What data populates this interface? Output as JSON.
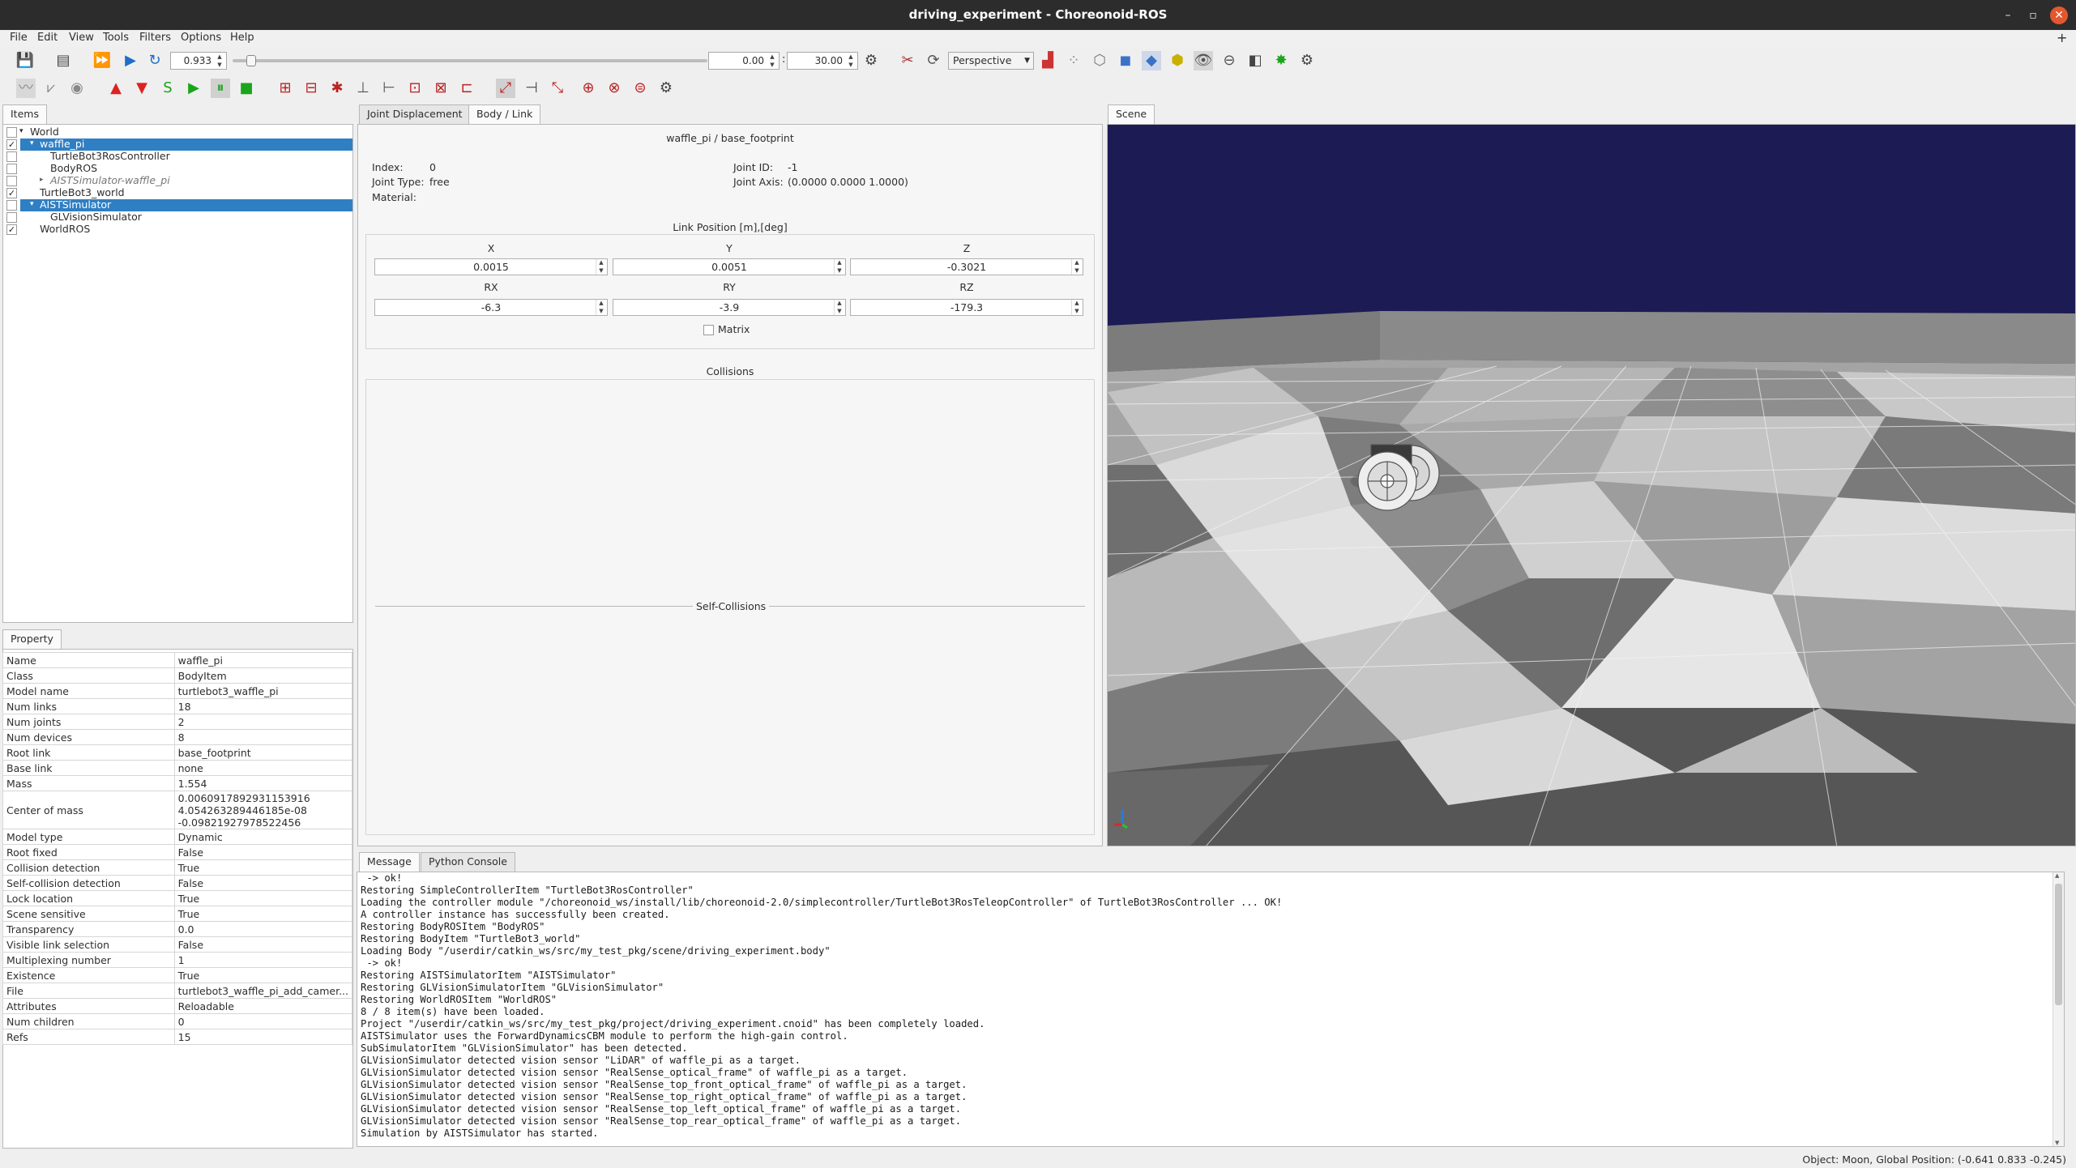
{
  "window": {
    "title": "driving_experiment - Choreonoid-ROS",
    "minimize": "–",
    "maximize": "▫",
    "close": "✕"
  },
  "menu": [
    "File",
    "Edit",
    "View",
    "Tools",
    "Filters",
    "Options",
    "Help"
  ],
  "menu_extra": "+",
  "toolbar": {
    "time_step": "0.933",
    "time_start": "0.00",
    "time_end": "30.00",
    "time_sep": ":",
    "view_mode": "Perspective",
    "slider_position": 0.03
  },
  "items_panel": {
    "tab": "Items",
    "tree": [
      {
        "label": "World",
        "checked": false,
        "selected": false
      },
      {
        "label": "waffle_pi",
        "checked": true,
        "selected": true
      },
      {
        "label": "TurtleBot3RosController",
        "checked": false,
        "selected": false
      },
      {
        "label": "BodyROS",
        "checked": false,
        "selected": false
      },
      {
        "label": "AISTSimulator-waffle_pi",
        "checked": false,
        "selected": false
      },
      {
        "label": "TurtleBot3_world",
        "checked": true,
        "selected": false
      },
      {
        "label": "AISTSimulator",
        "checked": false,
        "selected": true
      },
      {
        "label": "GLVisionSimulator",
        "checked": false,
        "selected": false
      },
      {
        "label": "WorldROS",
        "checked": true,
        "selected": false
      }
    ]
  },
  "property_panel": {
    "tab": "Property",
    "rows": [
      {
        "key": "Name",
        "value": "waffle_pi"
      },
      {
        "key": "Class",
        "value": "BodyItem"
      },
      {
        "key": "Model name",
        "value": "turtlebot3_waffle_pi"
      },
      {
        "key": "Num links",
        "value": "18"
      },
      {
        "key": "Num joints",
        "value": "2"
      },
      {
        "key": "Num devices",
        "value": "8"
      },
      {
        "key": "Root link",
        "value": "base_footprint"
      },
      {
        "key": "Base link",
        "value": "none"
      },
      {
        "key": "Mass",
        "value": "1.554"
      },
      {
        "key": "Center of mass",
        "value": "0.0060917892931153916\n4.054263289446185e-08\n-0.09821927978522456"
      },
      {
        "key": "Model type",
        "value": "Dynamic"
      },
      {
        "key": "Root fixed",
        "value": "False"
      },
      {
        "key": "Collision detection",
        "value": "True"
      },
      {
        "key": "Self-collision detection",
        "value": "False"
      },
      {
        "key": "Lock location",
        "value": "True"
      },
      {
        "key": "Scene sensitive",
        "value": "True"
      },
      {
        "key": "Transparency",
        "value": "0.0"
      },
      {
        "key": "Visible link selection",
        "value": "False"
      },
      {
        "key": "Multiplexing number",
        "value": "1"
      },
      {
        "key": "Existence",
        "value": "True"
      },
      {
        "key": "File",
        "value": "turtlebot3_waffle_pi_add_camer..."
      },
      {
        "key": "Attributes",
        "value": "Reloadable"
      },
      {
        "key": "Num children",
        "value": "0"
      },
      {
        "key": "Refs",
        "value": "15"
      }
    ]
  },
  "body_link": {
    "tabs": [
      "Joint Displacement",
      "Body / Link"
    ],
    "header": "waffle_pi / base_footprint",
    "index_label": "Index:",
    "index": "0",
    "joint_id_label": "Joint ID:",
    "joint_id": "-1",
    "joint_type_label": "Joint Type:",
    "joint_type": "free",
    "joint_axis_label": "Joint Axis:",
    "joint_axis": "(0.0000 0.0000 1.0000)",
    "material_label": "Material:",
    "link_position_title": "Link Position [m],[deg]",
    "axes": [
      "X",
      "Y",
      "Z"
    ],
    "position": [
      "0.0015",
      "0.0051",
      "-0.3021"
    ],
    "rot_axes": [
      "RX",
      "RY",
      "RZ"
    ],
    "rotation": [
      "-6.3",
      "-3.9",
      "-179.3"
    ],
    "matrix_label": "Matrix",
    "collisions_title": "Collisions",
    "self_collisions_title": "Self-Collisions"
  },
  "scene": {
    "tab": "Scene"
  },
  "message_panel": {
    "tabs": [
      "Message",
      "Python Console"
    ],
    "lines": [
      " -> ok!",
      "Restoring SimpleControllerItem \"TurtleBot3RosController\"",
      "Loading the controller module \"/choreonoid_ws/install/lib/choreonoid-2.0/simplecontroller/TurtleBot3RosTeleopController\" of TurtleBot3RosController ... OK!",
      "A controller instance has successfully been created.",
      "Restoring BodyROSItem \"BodyROS\"",
      "Restoring BodyItem \"TurtleBot3_world\"",
      "Loading Body \"/userdir/catkin_ws/src/my_test_pkg/scene/driving_experiment.body\"",
      " -> ok!",
      "Restoring AISTSimulatorItem \"AISTSimulator\"",
      "Restoring GLVisionSimulatorItem \"GLVisionSimulator\"",
      "Restoring WorldROSItem \"WorldROS\"",
      "8 / 8 item(s) have been loaded.",
      "Project \"/userdir/catkin_ws/src/my_test_pkg/project/driving_experiment.cnoid\" has been completely loaded.",
      "AISTSimulator uses the ForwardDynamicsCBM module to perform the high-gain control.",
      "SubSimulatorItem \"GLVisionSimulator\" has been detected.",
      "GLVisionSimulator detected vision sensor \"LiDAR\" of waffle_pi as a target.",
      "GLVisionSimulator detected vision sensor \"RealSense_optical_frame\" of waffle_pi as a target.",
      "GLVisionSimulator detected vision sensor \"RealSense_top_front_optical_frame\" of waffle_pi as a target.",
      "GLVisionSimulator detected vision sensor \"RealSense_top_right_optical_frame\" of waffle_pi as a target.",
      "GLVisionSimulator detected vision sensor \"RealSense_top_left_optical_frame\" of waffle_pi as a target.",
      "GLVisionSimulator detected vision sensor \"RealSense_top_rear_optical_frame\" of waffle_pi as a target.",
      "Simulation by AISTSimulator has started."
    ]
  },
  "status": "Object: Moon, Global Position: (-0.641 0.833 -0.245)"
}
